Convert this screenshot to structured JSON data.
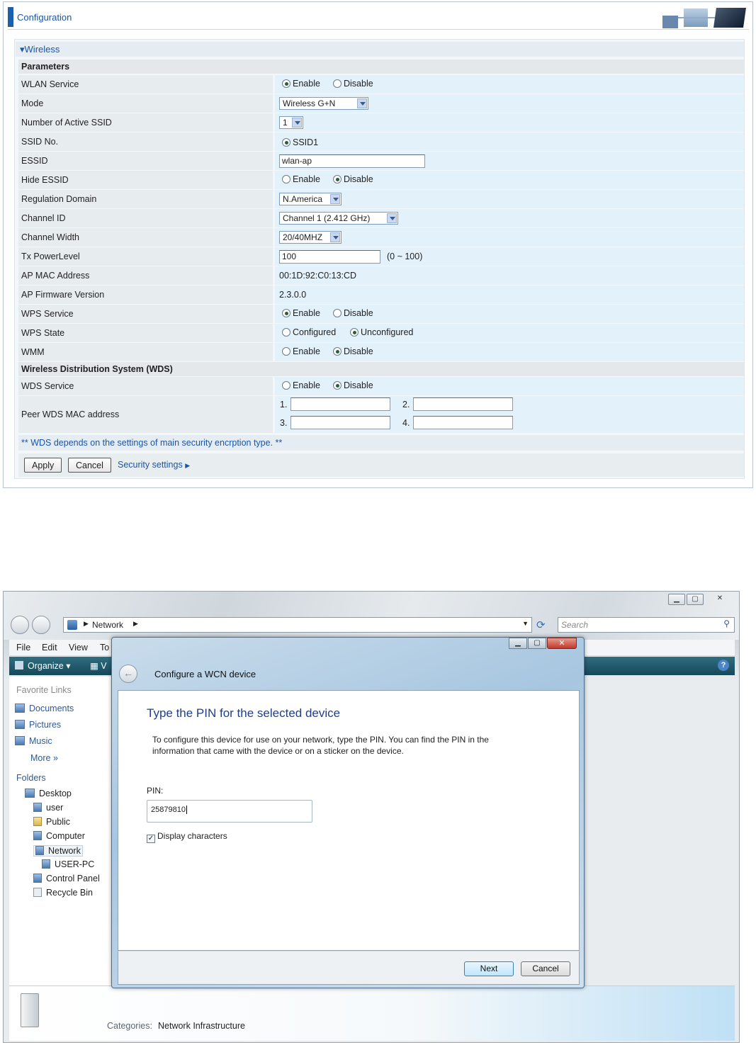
{
  "router": {
    "header_title": "Configuration",
    "section_title": "Wireless",
    "parameters_label": "Parameters",
    "wlan_service": {
      "label": "WLAN Service",
      "opt1": "Enable",
      "opt2": "Disable",
      "selected": "Enable"
    },
    "mode": {
      "label": "Mode",
      "value": "Wireless G+N"
    },
    "active_ssid": {
      "label": "Number of Active SSID",
      "value": "1"
    },
    "ssid_no": {
      "label": "SSID No.",
      "value": "SSID1"
    },
    "essid": {
      "label": "ESSID",
      "value": "wlan-ap"
    },
    "hide_essid": {
      "label": "Hide ESSID",
      "opt1": "Enable",
      "opt2": "Disable",
      "selected": "Disable"
    },
    "regulation": {
      "label": "Regulation Domain",
      "value": "N.America"
    },
    "channel_id": {
      "label": "Channel ID",
      "value": "Channel 1 (2.412 GHz)"
    },
    "channel_width": {
      "label": "Channel Width",
      "value": "20/40MHZ"
    },
    "tx_power": {
      "label": "Tx PowerLevel",
      "value": "100",
      "range": "(0 ~ 100)"
    },
    "ap_mac": {
      "label": "AP MAC Address",
      "value": "00:1D:92:C0:13:CD"
    },
    "ap_fw": {
      "label": "AP Firmware Version",
      "value": "2.3.0.0"
    },
    "wps_service": {
      "label": "WPS Service",
      "opt1": "Enable",
      "opt2": "Disable",
      "selected": "Enable"
    },
    "wps_state": {
      "label": "WPS State",
      "opt1": "Configured",
      "opt2": "Unconfigured",
      "selected": "Unconfigured"
    },
    "wmm": {
      "label": "WMM",
      "opt1": "Enable",
      "opt2": "Disable",
      "selected": "Disable"
    },
    "wds_section": "Wireless Distribution System (WDS)",
    "wds_service": {
      "label": "WDS Service",
      "opt1": "Enable",
      "opt2": "Disable",
      "selected": "Disable"
    },
    "peer_wds": {
      "label": "Peer WDS MAC address",
      "n1": "1.",
      "n2": "2.",
      "n3": "3.",
      "n4": "4.",
      "v1": "",
      "v2": "",
      "v3": "",
      "v4": ""
    },
    "wds_note": "** WDS depends on the settings of main security encrption type. **",
    "apply": "Apply",
    "cancel": "Cancel",
    "security_link": "Security settings"
  },
  "vista": {
    "address": "Network",
    "search_placeholder": "Search",
    "menu": [
      "File",
      "Edit",
      "View",
      "To"
    ],
    "toolbar": {
      "organize": "Organize",
      "views": "V"
    },
    "favorites_title": "Favorite Links",
    "favorites": [
      "Documents",
      "Pictures",
      "Music"
    ],
    "more": "More",
    "folders_title": "Folders",
    "folders": [
      "Desktop",
      "user",
      "Public",
      "Computer",
      "Network",
      "USER-PC",
      "Control Panel",
      "Recycle Bin"
    ],
    "details": {
      "label": "Categories:",
      "value": "Network Infrastructure"
    },
    "dialog": {
      "title": "Configure a WCN device",
      "heading": "Type the PIN for the selected device",
      "desc1": "To configure this device for use on your network, type the PIN. You can find the PIN in the",
      "desc2": "information that came with the device or on a sticker on the device.",
      "pin_label": "PIN:",
      "pin_value": "25879810",
      "display_chars": "Display characters",
      "display_checked": true,
      "next": "Next",
      "cancel": "Cancel"
    }
  }
}
